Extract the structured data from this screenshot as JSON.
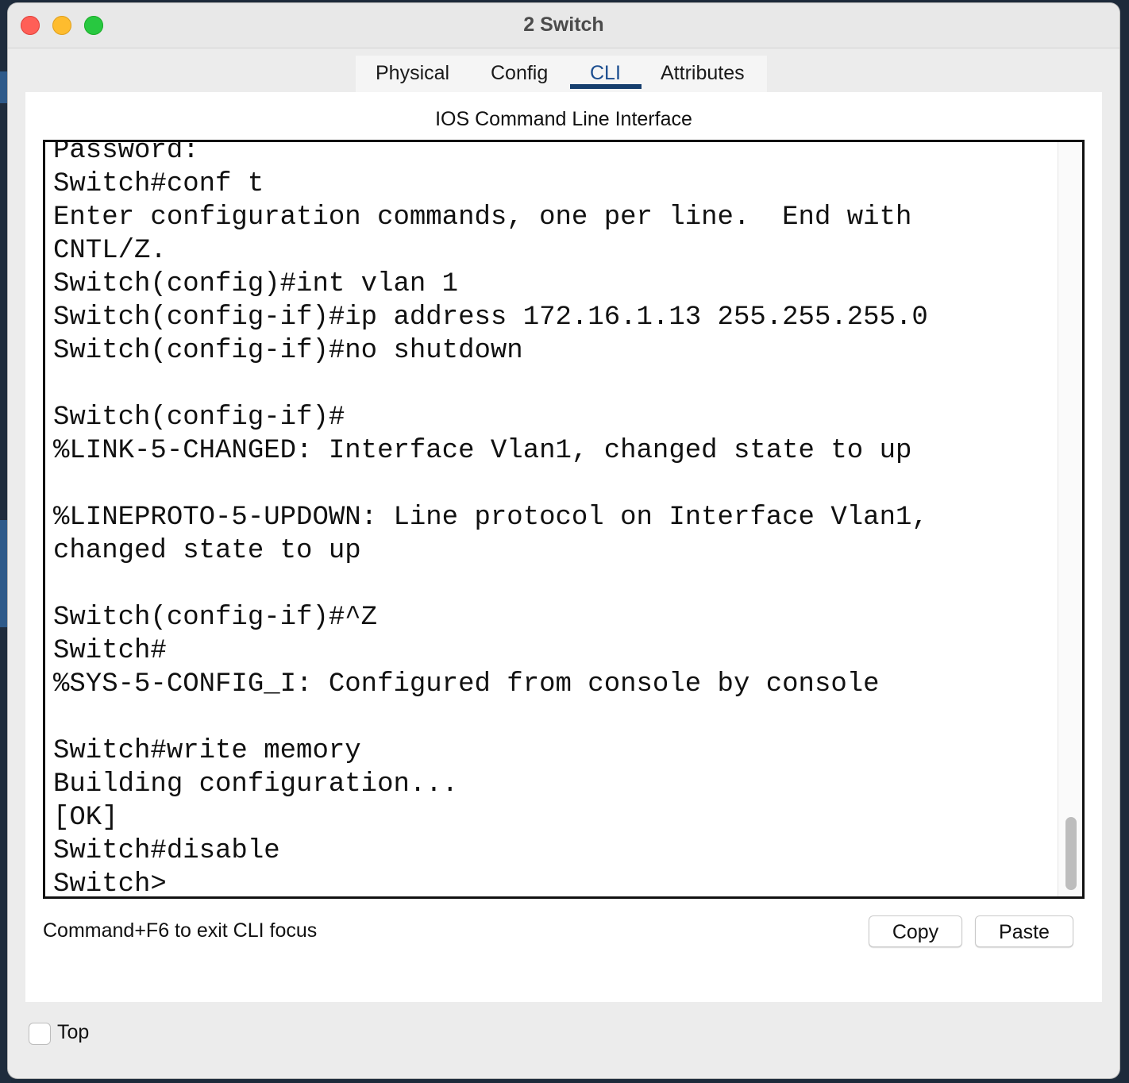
{
  "window": {
    "title": "2 Switch"
  },
  "tabs": [
    {
      "label": "Physical"
    },
    {
      "label": "Config"
    },
    {
      "label": "CLI",
      "active": true
    },
    {
      "label": "Attributes"
    }
  ],
  "panel": {
    "heading": "IOS Command Line Interface"
  },
  "terminal": {
    "text": "Password:\nSwitch#conf t\nEnter configuration commands, one per line.  End with\nCNTL/Z.\nSwitch(config)#int vlan 1\nSwitch(config-if)#ip address 172.16.1.13 255.255.255.0\nSwitch(config-if)#no shutdown\n\nSwitch(config-if)#\n%LINK-5-CHANGED: Interface Vlan1, changed state to up\n\n%LINEPROTO-5-UPDOWN: Line protocol on Interface Vlan1,\nchanged state to up\n\nSwitch(config-if)#^Z\nSwitch#\n%SYS-5-CONFIG_I: Configured from console by console\n\nSwitch#write memory\nBuilding configuration...\n[OK]\nSwitch#disable\nSwitch>"
  },
  "footer": {
    "hint": "Command+F6 to exit CLI focus",
    "copy_label": "Copy",
    "paste_label": "Paste"
  },
  "bottom": {
    "top_label": "Top",
    "top_checked": false
  },
  "colors": {
    "active_tab_underline": "#163f6e",
    "close": "#ff5f57",
    "minimize": "#febc2e",
    "maximize": "#28c840"
  }
}
